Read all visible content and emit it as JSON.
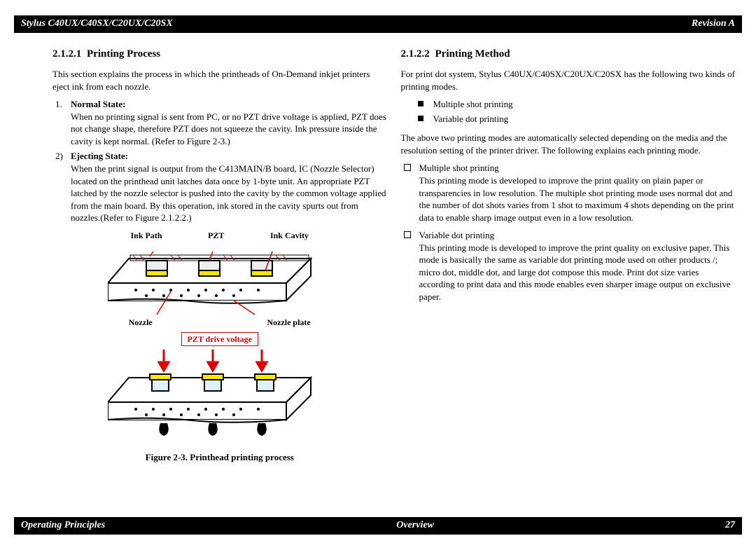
{
  "header": {
    "left": "Stylus C40UX/C40SX/C20UX/C20SX",
    "right": "Revision A"
  },
  "footer": {
    "left": "Operating Principles",
    "center": "Overview",
    "right": "27"
  },
  "left_col": {
    "heading_num": "2.1.2.1",
    "heading_title": "Printing Process",
    "intro": "This section explains the process in which the printheads of On-Demand inkjet printers eject ink from each nozzle.",
    "items": [
      {
        "num": "1.",
        "label": "Normal State:",
        "text": "When no printing signal is sent from PC, or no PZT drive voltage is applied, PZT does not change shape, therefore PZT does not squeeze the cavity. Ink pressure inside the cavity is kept normal. (Refer to Figure 2-3.)"
      },
      {
        "num": "2)",
        "label": "Ejecting State:",
        "text": "When the print signal is output from the C413MAIN/B board, IC (Nozzle Selector) located on the printhead unit latches data once by 1-byte unit. An appropriate PZT latched by the nozzle selector is pushed into the cavity by the common voltage applied from the main board. By this operation, ink stored in the cavity spurts out from nozzles.(Refer to Figure 2.1.2.2.)"
      }
    ],
    "diagram_labels": {
      "ink_path": "Ink Path",
      "pzt": "PZT",
      "ink_cavity": "Ink Cavity",
      "nozzle": "Nozzle",
      "nozzle_plate": "Nozzle plate",
      "pzt_drive_voltage": "PZT drive voltage"
    },
    "figure_caption": "Figure 2-3.  Printhead printing process"
  },
  "right_col": {
    "heading_num": "2.1.2.2",
    "heading_title": "Printing Method",
    "intro": "For print dot system, Stylus C40UX/C40SX/C20UX/C20SX has the following two kinds of printing modes.",
    "modes": [
      "Multiple shot printing",
      "Variable dot printing"
    ],
    "after_modes": "The above two printing modes are automatically selected depending on the media and the resolution setting of the printer driver. The following explains each printing mode.",
    "details": [
      {
        "title": "Multiple shot printing",
        "text": "This printing mode is developed to improve the print quality on plain paper or transparencies in low resolution. The multiple shot printing mode uses normal dot and the number of dot shots varies from 1 shot to maximum 4 shots depending on the print data to enable sharp image output even in a low resolution."
      },
      {
        "title": "Variable dot printing",
        "text": "This printing mode is developed to improve the print quality on exclusive paper. This mode is basically the same as variable dot printing mode used on other products /; micro dot, middle dot, and large dot compose this mode. Print dot size varies according to print data and this mode enables even sharper image output on exclusive paper."
      }
    ]
  }
}
